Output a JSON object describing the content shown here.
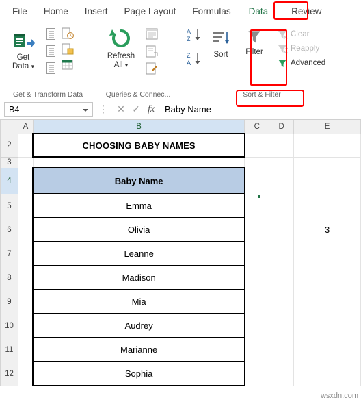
{
  "tabs": [
    {
      "label": "File",
      "active": false
    },
    {
      "label": "Home",
      "active": false
    },
    {
      "label": "Insert",
      "active": false
    },
    {
      "label": "Page Layout",
      "active": false
    },
    {
      "label": "Formulas",
      "active": false
    },
    {
      "label": "Data",
      "active": true
    },
    {
      "label": "Review",
      "active": false
    }
  ],
  "ribbon": {
    "groups": [
      {
        "name": "get-transform-data",
        "label": "Get & Transform Data",
        "big": {
          "line1": "Get",
          "line2": "Data",
          "caret": "⌄"
        }
      },
      {
        "name": "queries-connections",
        "label": "Queries & Connec...",
        "big": {
          "line1": "Refresh",
          "line2": "All",
          "caret": "⌄"
        }
      },
      {
        "name": "sort-filter",
        "label": "Sort & Filter",
        "sort_az": "A\nZ",
        "sort_za": "Z\nA",
        "sort_label": "Sort",
        "filter_label": "Filter",
        "items": [
          {
            "label": "Clear",
            "disabled": true
          },
          {
            "label": "Reapply",
            "disabled": true
          },
          {
            "label": "Advanced",
            "disabled": false
          }
        ]
      }
    ]
  },
  "formula_bar": {
    "name_box": "B4",
    "cancel_icon": "✕",
    "confirm_icon": "✓",
    "fx_icon": "fx",
    "value": "Baby Name"
  },
  "grid": {
    "columns": [
      "A",
      "B",
      "C",
      "D",
      "E"
    ],
    "selected_column": "B",
    "selected_row": "4",
    "rows": [
      {
        "num": "2",
        "b": "CHOOSING BABY NAMES",
        "style": "title",
        "e": ""
      },
      {
        "num": "3",
        "b": "",
        "style": "blank",
        "e": ""
      },
      {
        "num": "4",
        "b": "Baby Name",
        "style": "header",
        "e": ""
      },
      {
        "num": "5",
        "b": "Emma",
        "style": "data",
        "e": ""
      },
      {
        "num": "6",
        "b": "Olivia",
        "style": "data",
        "e": "3"
      },
      {
        "num": "7",
        "b": "Leanne",
        "style": "data",
        "e": ""
      },
      {
        "num": "8",
        "b": "Madison",
        "style": "data",
        "e": ""
      },
      {
        "num": "9",
        "b": "Mia",
        "style": "data",
        "e": ""
      },
      {
        "num": "10",
        "b": "Audrey",
        "style": "data",
        "e": ""
      },
      {
        "num": "11",
        "b": "Marianne",
        "style": "data",
        "e": ""
      },
      {
        "num": "12",
        "b": "Sophia",
        "style": "data",
        "e": ""
      }
    ]
  },
  "watermark": "wsxdn.com",
  "colors": {
    "excel_green": "#217346",
    "highlight_red": "#ff0000",
    "header_fill": "#b8cce4"
  }
}
